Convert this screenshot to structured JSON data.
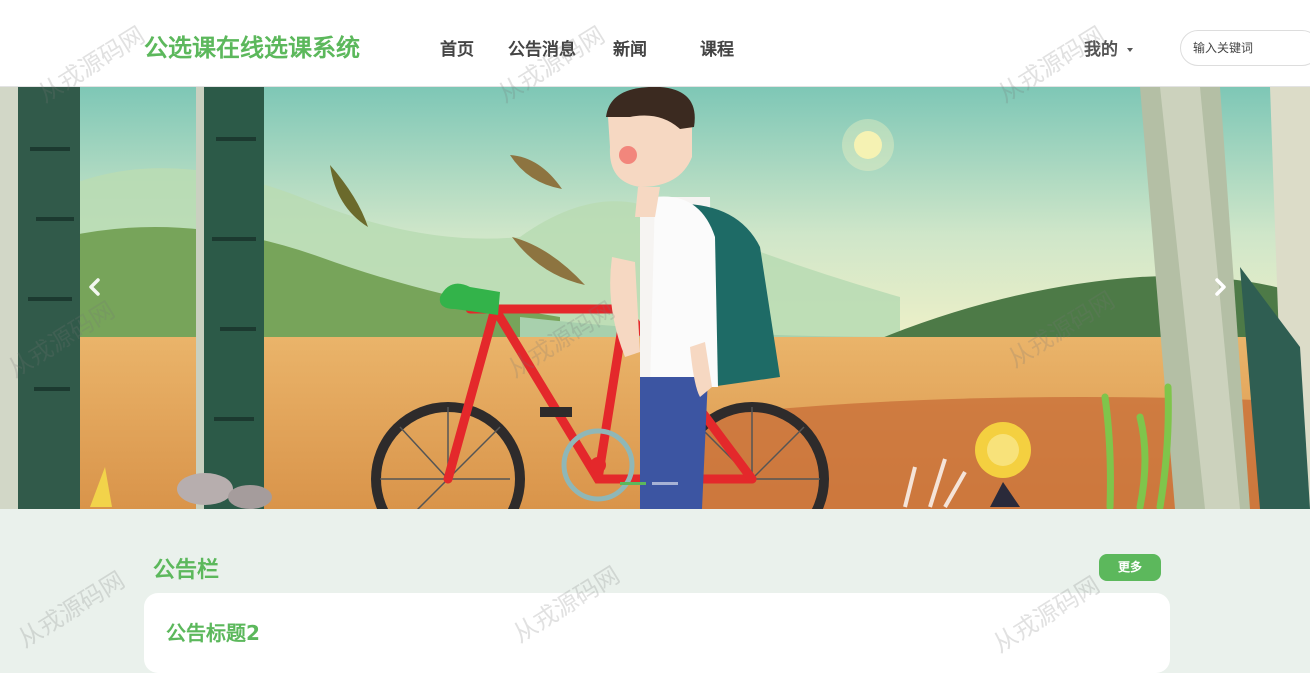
{
  "header": {
    "site_title": "公选课在线选课系统",
    "nav": [
      {
        "label": "首页"
      },
      {
        "label": "公告消息"
      },
      {
        "label": "新闻"
      },
      {
        "label": "课程"
      }
    ],
    "user_menu_label": "我的",
    "search_placeholder": "输入关键词"
  },
  "banner": {
    "active_slide": 0,
    "slide_count": 2,
    "prev_icon": "chevron-left-icon",
    "next_icon": "chevron-right-icon"
  },
  "notice_section": {
    "title": "公告栏",
    "more_label": "更多",
    "items": [
      {
        "title": "公告标题2"
      }
    ]
  },
  "watermark_text": "从戎源码网",
  "colors": {
    "accent": "#5cb85c",
    "page_bg": "#eaf1ec",
    "header_bg": "#ffffff"
  }
}
